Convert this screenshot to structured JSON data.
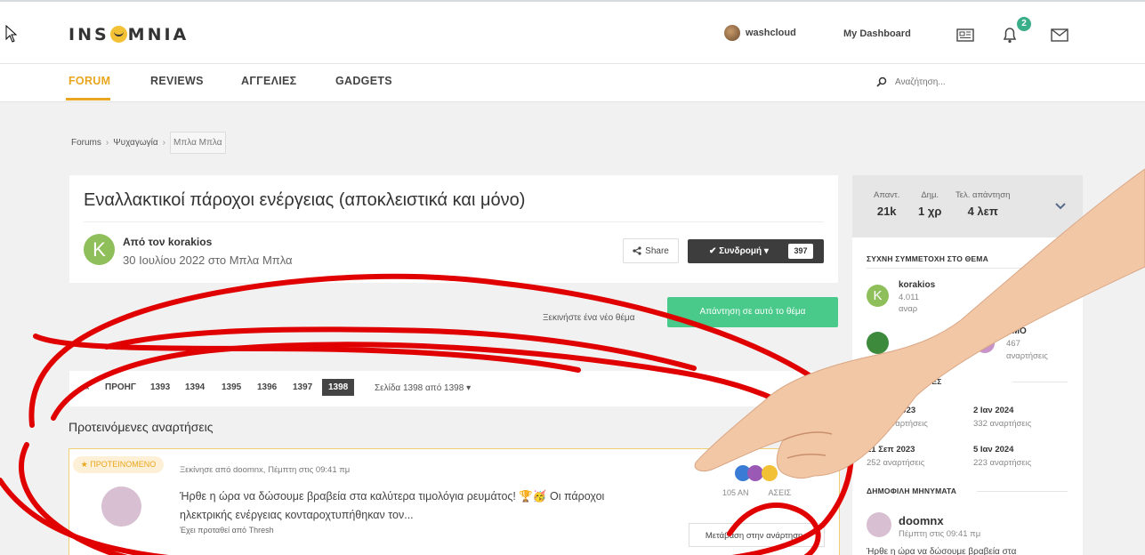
{
  "header": {
    "logo": "INS MNIA",
    "user_name": "washcloud",
    "dashboard_label": "My Dashboard",
    "notification_count": "2"
  },
  "nav": {
    "items": [
      "FORUM",
      "REVIEWS",
      "ΑΓΓΕΛΙΕΣ",
      "GADGETS"
    ],
    "search_placeholder": "Αναζήτηση..."
  },
  "breadcrumb": [
    "Forums",
    "Ψυχαγωγία",
    "Μπλα Μπλα"
  ],
  "topic": {
    "title": "Εναλλακτικοί πάροχοι ενέργειας (αποκλειστικά και μόνο)",
    "author_initial": "K",
    "author_line": "Από τον korakios",
    "date_line": "30 Ιουλίου 2022 στο Μπλα Μπλα",
    "share_label": "Share",
    "follow_label": "Συνδρομή",
    "follow_count": "397"
  },
  "actions": {
    "new_topic": "Ξεκινήστε ένα νέο θέμα",
    "reply": "Απάντηση σε αυτό το θέμα"
  },
  "pagination": {
    "first": "«",
    "prev": "ΠΡΟΗΓ",
    "pages": [
      "1393",
      "1394",
      "1395",
      "1396",
      "1397",
      "1398"
    ],
    "info": "Σελίδα 1398 από 1398"
  },
  "recommended": {
    "section_title": "Προτεινόμενες αναρτήσεις",
    "badge": "ΠΡΟΤΕΙΝΟΜΕΝΟ",
    "meta": "Ξεκίνησε από doomnx, Πέμπτη στις 09:41 πμ",
    "text_line1": "Ήρθε η ώρα να δώσουμε βραβεία στα καλύτερα τιμολόγια ρευμάτος! 🏆🥳 Οι πάροχοι",
    "text_line2": "ηλεκτρικής ενέργειας κονταροχτυπήθηκαν τον...",
    "suggested_by": "Έχει προταθεί από Thresh",
    "reactions_count": "105 ΑΝ",
    "reactions_suffix": "ΑΣΕΙΣ",
    "go_label": "Μετάβαση στην ανάρτηση"
  },
  "sidebar": {
    "stats": [
      {
        "label": "Απαντ.",
        "value": "21k"
      },
      {
        "label": "Δημ.",
        "value": "1 χρ"
      },
      {
        "label": "Τελ. απάντηση",
        "value": "4 λεπ"
      }
    ],
    "frequent_title": "ΣΥΧΝΗ ΣΥΜΜΕΤΟΧΗ ΣΤΟ ΘΕΜΑ",
    "frequent_user": {
      "initial": "K",
      "name": "korakios",
      "count": "4.011",
      "unit": "αναρ"
    },
    "frequent_user2": {
      "name": "ΥΜΟ",
      "count": "467",
      "unit": "αναρτήσεις"
    },
    "days_title": "ΗΜΕΡΕΣ",
    "days": [
      {
        "date": "2023",
        "posts": "αναρτήσεις"
      },
      {
        "date": "2 Ιαν 2024",
        "posts": "332 αναρτήσεις"
      },
      {
        "date": "21 Σεπ 2023",
        "posts": "252 αναρτήσεις"
      },
      {
        "date": "5 Ιαν 2024",
        "posts": "223 αναρτήσεις"
      }
    ],
    "popular_title": "ΔΗΜΟΦΙΛΗ ΜΗΝΥΜΑΤΑ",
    "popular": {
      "name": "doomnx",
      "date": "Πέμπτη στις 09:41 πμ",
      "text": "Ήρθε η ώρα να δώσουμε βραβεία στα"
    }
  },
  "colors": {
    "accent": "#e9a61e",
    "reply": "#49c98a",
    "annotation": "#e00000"
  }
}
